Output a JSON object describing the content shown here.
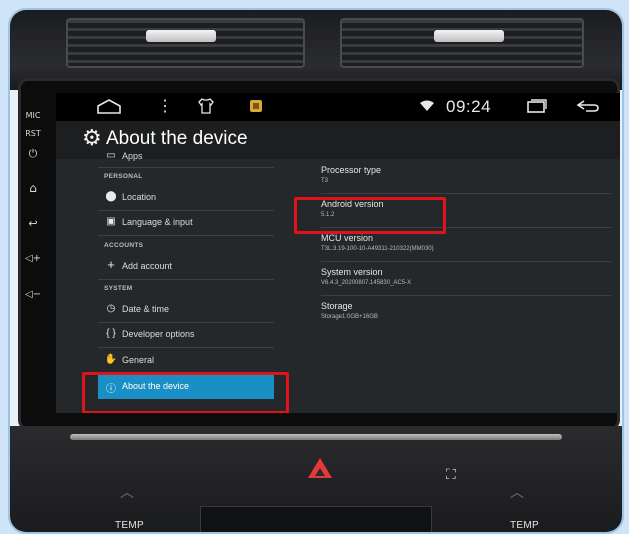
{
  "side_buttons": [
    {
      "label": "MIC",
      "icon": "mic-label"
    },
    {
      "label": "RST",
      "icon": "reset-label"
    },
    {
      "label": "⏻",
      "icon": "power-icon"
    },
    {
      "label": "⌂",
      "icon": "home-icon"
    },
    {
      "label": "↩",
      "icon": "back-icon"
    },
    {
      "label": "◁+",
      "icon": "volume-up-icon"
    },
    {
      "label": "◁−",
      "icon": "volume-down-icon"
    }
  ],
  "statusbar": {
    "time": "09:24",
    "icons": [
      "home-outline-icon",
      "more-vert-icon",
      "shirt-icon",
      "app-icon",
      "wifi-icon",
      "recent-apps-icon",
      "back-arrow-icon"
    ]
  },
  "header": {
    "title": "About the device",
    "icon": "gear-icon"
  },
  "menu": {
    "items": [
      {
        "type": "item",
        "label": "Apps",
        "icon": "apps-icon"
      },
      {
        "type": "section",
        "label": "PERSONAL"
      },
      {
        "type": "item",
        "label": "Location",
        "icon": "location-pin-icon"
      },
      {
        "type": "item",
        "label": "Language & input",
        "icon": "keyboard-icon"
      },
      {
        "type": "section",
        "label": "ACCOUNTS"
      },
      {
        "type": "item",
        "label": "Add account",
        "icon": "plus-icon"
      },
      {
        "type": "section",
        "label": "SYSTEM"
      },
      {
        "type": "item",
        "label": "Date & time",
        "icon": "clock-icon"
      },
      {
        "type": "item",
        "label": "Developer options",
        "icon": "braces-icon"
      },
      {
        "type": "item",
        "label": "General",
        "icon": "hand-icon"
      },
      {
        "type": "item",
        "label": "About the device",
        "icon": "info-icon",
        "active": true
      }
    ]
  },
  "info": [
    {
      "label": "Processor type",
      "value": "T3"
    },
    {
      "label": "Android version",
      "value": "5.1.2"
    },
    {
      "label": "MCU version",
      "value": "T3L.3.19-100-10-A49311-210322(MM030)"
    },
    {
      "label": "System version",
      "value": "V6.4.3_20200807.145830_AC5-X"
    },
    {
      "label": "Storage",
      "value": "Storage1:0GB+16GB"
    }
  ],
  "console": {
    "temp_left": "TEMP",
    "temp_right": "TEMP"
  },
  "colors": {
    "highlight": "#e0131b",
    "active_item": "#1a8fc6"
  }
}
